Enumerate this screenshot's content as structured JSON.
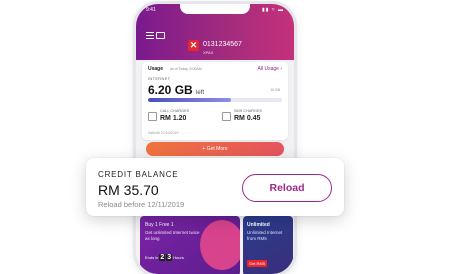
{
  "status": {
    "time": "9:41",
    "icons": "▮▮ ≈ ▬"
  },
  "header": {
    "logo_text": "✕",
    "account_number": "0131234567",
    "plan": "XPAX"
  },
  "usage": {
    "title": "Usage",
    "subtitle": "as of Today, 9:00AM",
    "all_usage_label": "All Usage ›",
    "internet_label": "INTERNET",
    "data_value": "6.20 GB",
    "data_left": "left",
    "data_total": "10 GB",
    "progress_fraction": 0.62,
    "call_label": "CALL CHARGES",
    "call_value": "RM 1.20",
    "sms_label": "SMS CHARGES",
    "sms_value": "RM 0.45",
    "valid_text": "Valid till 27/10/2019"
  },
  "get_more": {
    "label": "+ Get More"
  },
  "credit": {
    "label": "CREDIT BALANCE",
    "amount": "RM 35.70",
    "reload_before": "Reload before 12/11/2019",
    "reload_button": "Reload"
  },
  "promos": [
    {
      "title": "Buy 1 Free 1",
      "desc": "Get unlimited Internet twice as long",
      "timer_prefix": "Ends in",
      "timer_d1": "2",
      "timer_d2": "3",
      "timer_suffix": "Hours"
    },
    {
      "title": "Unlimited",
      "desc": "Unlimited Internet from RM5",
      "badge": "Get RM5"
    }
  ],
  "colors": {
    "brand": "#9b2a8d",
    "header_start": "#7a1a8e",
    "header_end": "#c5317a",
    "cta": "#f0733e",
    "logo": "#e8262d"
  }
}
